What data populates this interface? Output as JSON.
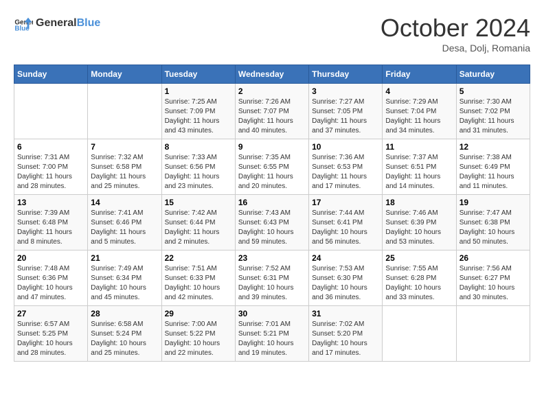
{
  "header": {
    "logo_line1": "General",
    "logo_line2": "Blue",
    "month_title": "October 2024",
    "subtitle": "Desa, Dolj, Romania"
  },
  "weekdays": [
    "Sunday",
    "Monday",
    "Tuesday",
    "Wednesday",
    "Thursday",
    "Friday",
    "Saturday"
  ],
  "weeks": [
    [
      {
        "day": "",
        "info": ""
      },
      {
        "day": "",
        "info": ""
      },
      {
        "day": "1",
        "info": "Sunrise: 7:25 AM\nSunset: 7:09 PM\nDaylight: 11 hours and 43 minutes."
      },
      {
        "day": "2",
        "info": "Sunrise: 7:26 AM\nSunset: 7:07 PM\nDaylight: 11 hours and 40 minutes."
      },
      {
        "day": "3",
        "info": "Sunrise: 7:27 AM\nSunset: 7:05 PM\nDaylight: 11 hours and 37 minutes."
      },
      {
        "day": "4",
        "info": "Sunrise: 7:29 AM\nSunset: 7:04 PM\nDaylight: 11 hours and 34 minutes."
      },
      {
        "day": "5",
        "info": "Sunrise: 7:30 AM\nSunset: 7:02 PM\nDaylight: 11 hours and 31 minutes."
      }
    ],
    [
      {
        "day": "6",
        "info": "Sunrise: 7:31 AM\nSunset: 7:00 PM\nDaylight: 11 hours and 28 minutes."
      },
      {
        "day": "7",
        "info": "Sunrise: 7:32 AM\nSunset: 6:58 PM\nDaylight: 11 hours and 25 minutes."
      },
      {
        "day": "8",
        "info": "Sunrise: 7:33 AM\nSunset: 6:56 PM\nDaylight: 11 hours and 23 minutes."
      },
      {
        "day": "9",
        "info": "Sunrise: 7:35 AM\nSunset: 6:55 PM\nDaylight: 11 hours and 20 minutes."
      },
      {
        "day": "10",
        "info": "Sunrise: 7:36 AM\nSunset: 6:53 PM\nDaylight: 11 hours and 17 minutes."
      },
      {
        "day": "11",
        "info": "Sunrise: 7:37 AM\nSunset: 6:51 PM\nDaylight: 11 hours and 14 minutes."
      },
      {
        "day": "12",
        "info": "Sunrise: 7:38 AM\nSunset: 6:49 PM\nDaylight: 11 hours and 11 minutes."
      }
    ],
    [
      {
        "day": "13",
        "info": "Sunrise: 7:39 AM\nSunset: 6:48 PM\nDaylight: 11 hours and 8 minutes."
      },
      {
        "day": "14",
        "info": "Sunrise: 7:41 AM\nSunset: 6:46 PM\nDaylight: 11 hours and 5 minutes."
      },
      {
        "day": "15",
        "info": "Sunrise: 7:42 AM\nSunset: 6:44 PM\nDaylight: 11 hours and 2 minutes."
      },
      {
        "day": "16",
        "info": "Sunrise: 7:43 AM\nSunset: 6:43 PM\nDaylight: 10 hours and 59 minutes."
      },
      {
        "day": "17",
        "info": "Sunrise: 7:44 AM\nSunset: 6:41 PM\nDaylight: 10 hours and 56 minutes."
      },
      {
        "day": "18",
        "info": "Sunrise: 7:46 AM\nSunset: 6:39 PM\nDaylight: 10 hours and 53 minutes."
      },
      {
        "day": "19",
        "info": "Sunrise: 7:47 AM\nSunset: 6:38 PM\nDaylight: 10 hours and 50 minutes."
      }
    ],
    [
      {
        "day": "20",
        "info": "Sunrise: 7:48 AM\nSunset: 6:36 PM\nDaylight: 10 hours and 47 minutes."
      },
      {
        "day": "21",
        "info": "Sunrise: 7:49 AM\nSunset: 6:34 PM\nDaylight: 10 hours and 45 minutes."
      },
      {
        "day": "22",
        "info": "Sunrise: 7:51 AM\nSunset: 6:33 PM\nDaylight: 10 hours and 42 minutes."
      },
      {
        "day": "23",
        "info": "Sunrise: 7:52 AM\nSunset: 6:31 PM\nDaylight: 10 hours and 39 minutes."
      },
      {
        "day": "24",
        "info": "Sunrise: 7:53 AM\nSunset: 6:30 PM\nDaylight: 10 hours and 36 minutes."
      },
      {
        "day": "25",
        "info": "Sunrise: 7:55 AM\nSunset: 6:28 PM\nDaylight: 10 hours and 33 minutes."
      },
      {
        "day": "26",
        "info": "Sunrise: 7:56 AM\nSunset: 6:27 PM\nDaylight: 10 hours and 30 minutes."
      }
    ],
    [
      {
        "day": "27",
        "info": "Sunrise: 6:57 AM\nSunset: 5:25 PM\nDaylight: 10 hours and 28 minutes."
      },
      {
        "day": "28",
        "info": "Sunrise: 6:58 AM\nSunset: 5:24 PM\nDaylight: 10 hours and 25 minutes."
      },
      {
        "day": "29",
        "info": "Sunrise: 7:00 AM\nSunset: 5:22 PM\nDaylight: 10 hours and 22 minutes."
      },
      {
        "day": "30",
        "info": "Sunrise: 7:01 AM\nSunset: 5:21 PM\nDaylight: 10 hours and 19 minutes."
      },
      {
        "day": "31",
        "info": "Sunrise: 7:02 AM\nSunset: 5:20 PM\nDaylight: 10 hours and 17 minutes."
      },
      {
        "day": "",
        "info": ""
      },
      {
        "day": "",
        "info": ""
      }
    ]
  ]
}
